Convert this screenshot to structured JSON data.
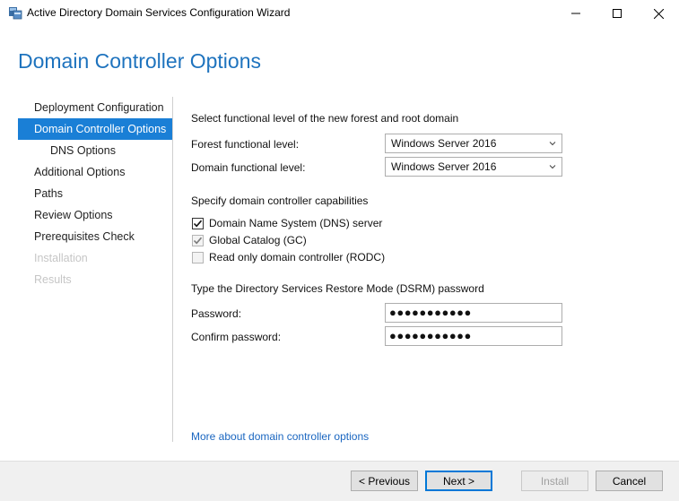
{
  "window": {
    "title": "Active Directory Domain Services Configuration Wizard",
    "icon": "server-icon",
    "controls": [
      "minimize-icon",
      "maximize-icon",
      "close-icon"
    ]
  },
  "page_title": "Domain Controller Options",
  "nav": {
    "items": [
      {
        "label": "Deployment Configuration",
        "state": "normal"
      },
      {
        "label": "Domain Controller Options",
        "state": "active"
      },
      {
        "label": "DNS Options",
        "state": "normal"
      },
      {
        "label": "Additional Options",
        "state": "normal"
      },
      {
        "label": "Paths",
        "state": "normal"
      },
      {
        "label": "Review Options",
        "state": "normal"
      },
      {
        "label": "Prerequisites Check",
        "state": "normal"
      },
      {
        "label": "Installation",
        "state": "disabled"
      },
      {
        "label": "Results",
        "state": "disabled"
      }
    ]
  },
  "functional_level": {
    "heading": "Select functional level of the new forest and root domain",
    "forest_label": "Forest functional level:",
    "forest_value": "Windows Server 2016",
    "domain_label": "Domain functional level:",
    "domain_value": "Windows Server 2016"
  },
  "capabilities": {
    "heading": "Specify domain controller capabilities",
    "options": [
      {
        "label": "Domain Name System (DNS) server",
        "checked": true,
        "enabled": true
      },
      {
        "label": "Global Catalog (GC)",
        "checked": true,
        "enabled": false
      },
      {
        "label": "Read only domain controller (RODC)",
        "checked": false,
        "enabled": false
      }
    ]
  },
  "dsrm": {
    "heading": "Type the Directory Services Restore Mode (DSRM) password",
    "password_label": "Password:",
    "password_value": "●●●●●●●●●●●",
    "confirm_label": "Confirm password:",
    "confirm_value": "●●●●●●●●●●●"
  },
  "more_link": "More about domain controller options",
  "buttons": {
    "previous": "< Previous",
    "next": "Next >",
    "install": "Install",
    "cancel": "Cancel"
  },
  "colors": {
    "accent": "#1a7fd6",
    "title": "#1e73be",
    "link": "#1a66c0"
  }
}
